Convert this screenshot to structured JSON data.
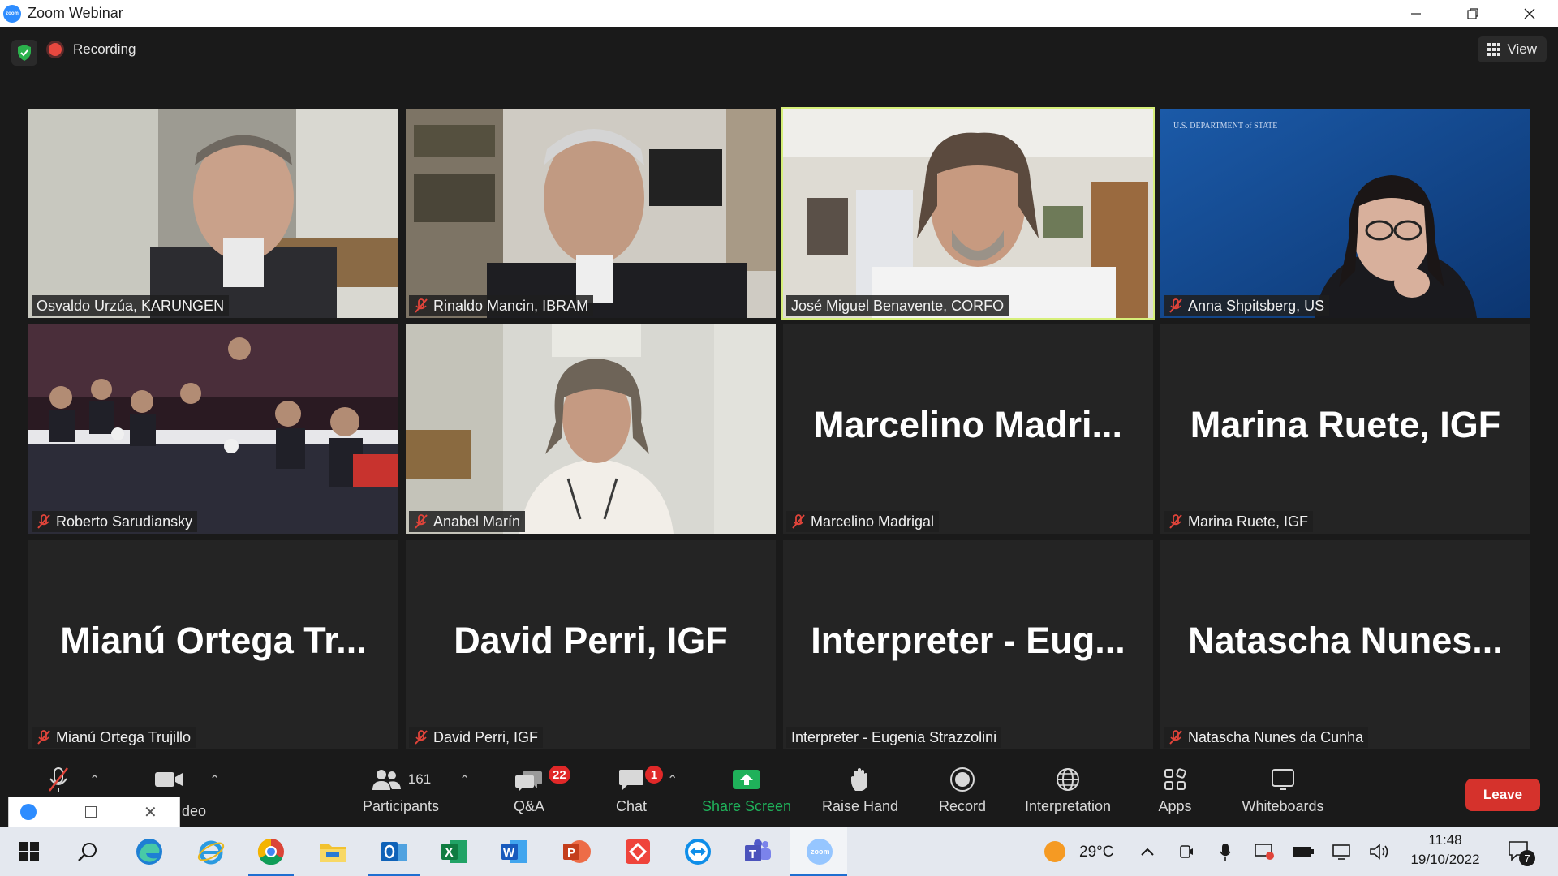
{
  "window": {
    "title": "Zoom Webinar",
    "minimize": "—",
    "maximize": "❐",
    "close": "✕"
  },
  "topbar": {
    "recording_label": "Recording",
    "view_label": "View"
  },
  "tiles": [
    {
      "name": "Osvaldo Urzúa, KARUNGEN",
      "muted": false,
      "video": true
    },
    {
      "name": "Rinaldo Mancin, IBRAM",
      "muted": true,
      "video": true
    },
    {
      "name": "José Miguel Benavente, CORFO",
      "muted": false,
      "video": true,
      "active": true
    },
    {
      "name": "Anna Shpitsberg, US",
      "muted": true,
      "video": true
    },
    {
      "name": "Roberto Sarudiansky",
      "muted": true,
      "video": true
    },
    {
      "name": "Anabel Marín",
      "muted": true,
      "video": true
    },
    {
      "name": "Marcelino Madrigal",
      "big": "Marcelino  Madri...",
      "muted": true,
      "video": false
    },
    {
      "name": "Marina Ruete, IGF",
      "big": "Marina Ruete, IGF",
      "muted": true,
      "video": false
    },
    {
      "name": "Mianú Ortega Trujillo",
      "big": "Mianú  Ortega  Tr...",
      "muted": true,
      "video": false
    },
    {
      "name": "David Perri, IGF",
      "big": "David Perri, IGF",
      "muted": true,
      "video": false
    },
    {
      "name": "Interpreter - Eugenia Strazzolini",
      "big": "Interpreter  -  Eug...",
      "muted": false,
      "video": false
    },
    {
      "name": "Natascha Nunes da Cunha",
      "big": "Natascha  Nunes...",
      "muted": true,
      "video": false
    }
  ],
  "toolbar": {
    "video_partial": "deo",
    "participants_label": "Participants",
    "participants_count": "161",
    "qa_label": "Q&A",
    "qa_badge": "22",
    "chat_label": "Chat",
    "chat_badge": "1",
    "share_label": "Share Screen",
    "raise_label": "Raise Hand",
    "record_label": "Record",
    "interpretation_label": "Interpretation",
    "apps_label": "Apps",
    "whiteboards_label": "Whiteboards",
    "leave_label": "Leave"
  },
  "taskbar": {
    "temperature": "29°C",
    "time": "11:48",
    "date": "19/10/2022",
    "notifications": "7"
  },
  "colors": {
    "active_border": "#d6ef7a",
    "leave": "#d5322c",
    "share": "#1fb15a",
    "badge": "#e02828",
    "mute": "#e0443a"
  }
}
